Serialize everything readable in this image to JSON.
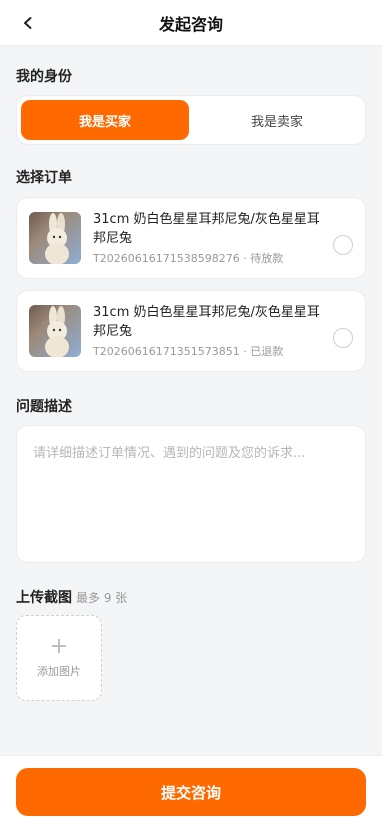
{
  "header": {
    "title": "发起咨询"
  },
  "identity": {
    "section_title": "我的身份",
    "buyer_label": "我是买家",
    "seller_label": "我是卖家",
    "selected": "buyer"
  },
  "orders": {
    "section_title": "选择订单",
    "items": [
      {
        "name": "31cm 奶白色星星耳邦尼兔/灰色星星耳邦尼兔",
        "order_no": "T20260616171538598276",
        "status": "待放款"
      },
      {
        "name": "31cm 奶白色星星耳邦尼兔/灰色星星耳邦尼兔",
        "order_no": "T20260616171351573851",
        "status": "已退款"
      }
    ]
  },
  "description": {
    "section_title": "问题描述",
    "placeholder": "请详细描述订单情况、遇到的问题及您的诉求...",
    "value": ""
  },
  "upload": {
    "section_title": "上传截图",
    "hint": "最多 9 张",
    "add_label": "添加图片"
  },
  "submit": {
    "label": "提交咨询"
  },
  "colors": {
    "accent": "#ff6a00",
    "background": "#f4f5f7"
  }
}
